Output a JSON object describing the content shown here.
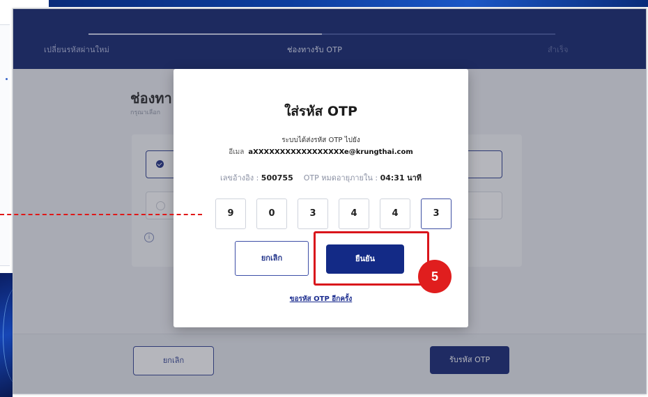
{
  "stepper": {
    "steps": [
      {
        "label": "เปลี่ยนรหัสผ่านใหม่",
        "state": "done"
      },
      {
        "label": "ช่องทางรับ OTP",
        "state": "active"
      },
      {
        "label": "สำเร็จ",
        "state": "pending"
      }
    ]
  },
  "page": {
    "heading": "ช่องทา",
    "subtitle": "กรุณาเลือก"
  },
  "footer": {
    "cancel_label": "ยกเลิก",
    "request_otp_label": "รับรหัส OTP"
  },
  "otp_dialog": {
    "title": "ใส่รหัส OTP",
    "sent_to_text": "ระบบได้ส่งรหัส OTP ไปยัง",
    "email_label": "อีเมล",
    "email_value": "aXXXXXXXXXXXXXXXXXe@krungthai.com",
    "ref_label": "เลขอ้างอิง :",
    "ref_value": "500755",
    "expiry_label": "OTP หมดอายุภายใน :",
    "expiry_value": "04:31",
    "expiry_unit": "นาที",
    "otp_digits": [
      "9",
      "0",
      "3",
      "4",
      "4",
      "3"
    ],
    "cancel_label": "ยกเลิก",
    "confirm_label": "ยืนยัน",
    "resend_label": "ขอรหัส OTP อีกครั้ง"
  },
  "annotation": {
    "step_number": "5",
    "color": "#e01e1e"
  },
  "colors": {
    "header_navy": "#0b1d69",
    "primary_button": "#132a86",
    "annotation_red": "#d9151b"
  }
}
